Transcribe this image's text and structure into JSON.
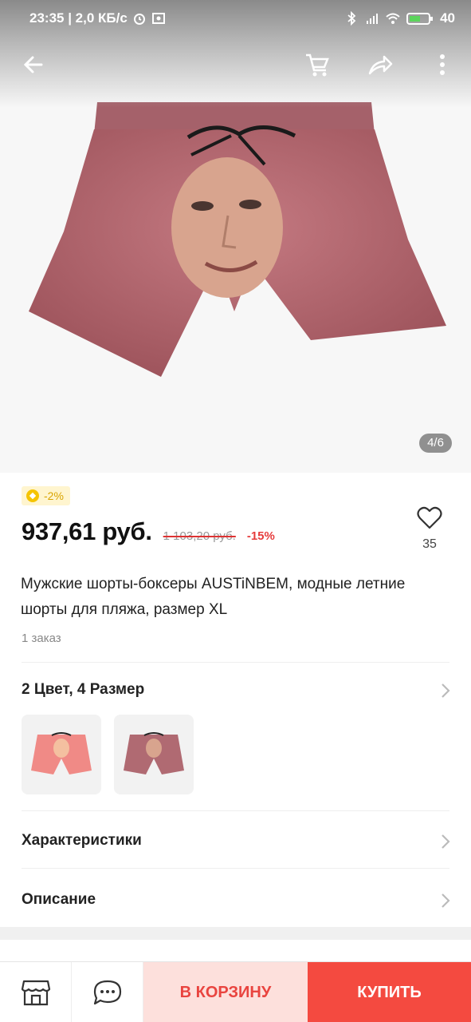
{
  "status_bar": {
    "time_speed": "23:35 | 2,0 КБ/с",
    "battery": "40"
  },
  "app_bar": {
    "back_icon": "arrow-left-icon",
    "cart_icon": "cart-icon",
    "share_icon": "share-icon",
    "more_icon": "more-vertical-icon"
  },
  "gallery": {
    "counter": "4/6"
  },
  "coupon": {
    "label": "-2%",
    "icon": "coin-icon"
  },
  "price": {
    "current": "937,61 руб.",
    "old": "1 103,20 руб.",
    "discount": "-15%"
  },
  "favorites": {
    "icon": "heart-icon",
    "count": "35"
  },
  "product": {
    "title": "Мужские шорты-боксеры AUSTiNBEM, модные летние шорты для пляжа, размер XL",
    "orders": "1 заказ"
  },
  "variants": {
    "label": "2 Цвет, 4 Размер"
  },
  "sections": {
    "specs": "Характеристики",
    "description": "Описание"
  },
  "bottom_bar": {
    "store_icon": "store-icon",
    "chat_icon": "chat-icon",
    "add_to_cart": "В КОРЗИНУ",
    "buy": "КУПИТЬ"
  },
  "colors": {
    "accent": "#f44a40",
    "accent_light": "#fde0dc",
    "coupon_bg": "#fff5cf",
    "coupon_text": "#d9a400"
  }
}
